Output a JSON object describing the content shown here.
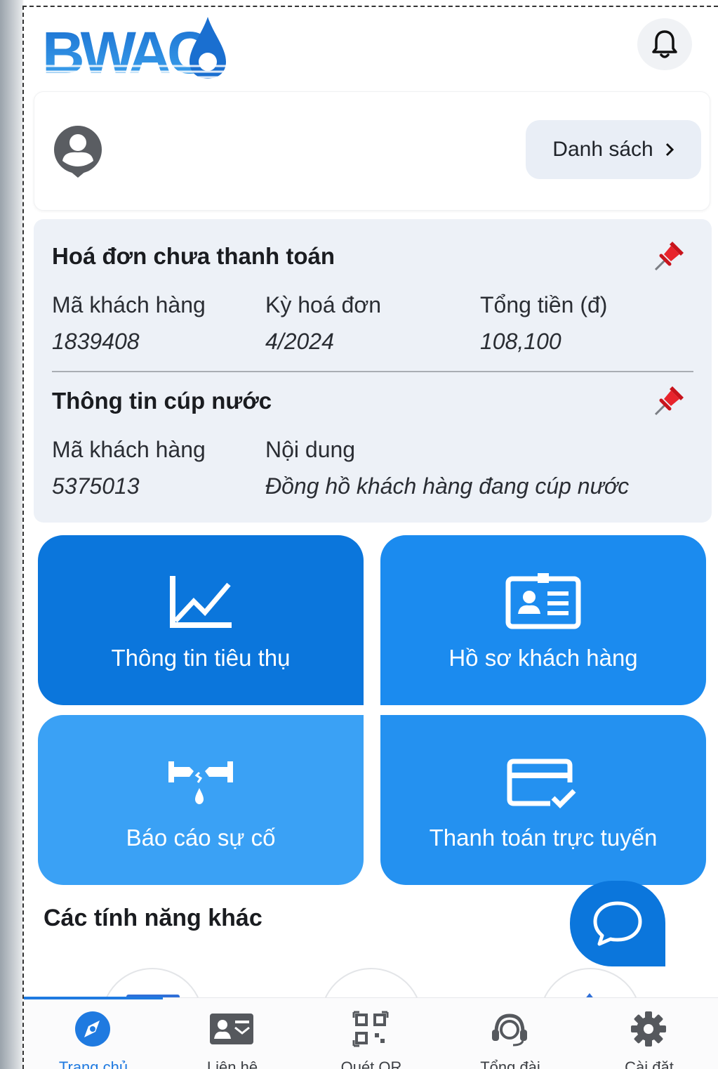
{
  "header": {
    "logo_text": "BWACO",
    "bell_icon": "bell-icon"
  },
  "account": {
    "avatar_icon": "user-avatar-icon",
    "list_button_label": "Danh sách",
    "list_button_icon": "chevron-right-icon"
  },
  "unpaid_bill": {
    "title": "Hoá đơn chưa thanh toán",
    "pin_icon": "pin-icon",
    "columns": [
      {
        "label": "Mã khách hàng",
        "value": "1839408"
      },
      {
        "label": "Kỳ hoá đơn",
        "value": "4/2024"
      },
      {
        "label": "Tổng tiền (đ)",
        "value": "108,100"
      }
    ]
  },
  "water_cut": {
    "title": "Thông tin cúp nước",
    "pin_icon": "pin-icon",
    "columns": [
      {
        "label": "Mã khách hàng",
        "value": "5375013"
      },
      {
        "label": "Nội dung",
        "value": "Đồng hồ khách hàng đang cúp nước"
      }
    ]
  },
  "tiles": [
    {
      "label": "Thông tin tiêu thụ",
      "icon": "line-chart-icon",
      "color": "#0b76dc"
    },
    {
      "label": "Hồ sơ khách hàng",
      "icon": "id-card-icon",
      "color": "#1b8bef"
    },
    {
      "label": "Báo cáo sự cố",
      "icon": "leaking-pipe-icon",
      "color": "#3aa1f5"
    },
    {
      "label": "Thanh toán trực tuyến",
      "icon": "card-check-icon",
      "color": "#2491f0"
    }
  ],
  "other_features": {
    "title": "Các tính năng khác",
    "chat_icon": "chat-bubble-icon"
  },
  "bottom_nav": {
    "active": "Trang chủ",
    "items": [
      {
        "label": "Trang chủ",
        "icon": "compass-icon"
      },
      {
        "label": "Liên hệ",
        "icon": "contact-card-icon"
      },
      {
        "label": "Quét QR",
        "icon": "qr-code-icon"
      },
      {
        "label": "Tổng đài",
        "icon": "headset-icon"
      },
      {
        "label": "Cài đặt",
        "icon": "gear-icon"
      }
    ]
  },
  "colors": {
    "brand_blue": "#1f7ae0",
    "panel_bg": "#edf1f7"
  }
}
